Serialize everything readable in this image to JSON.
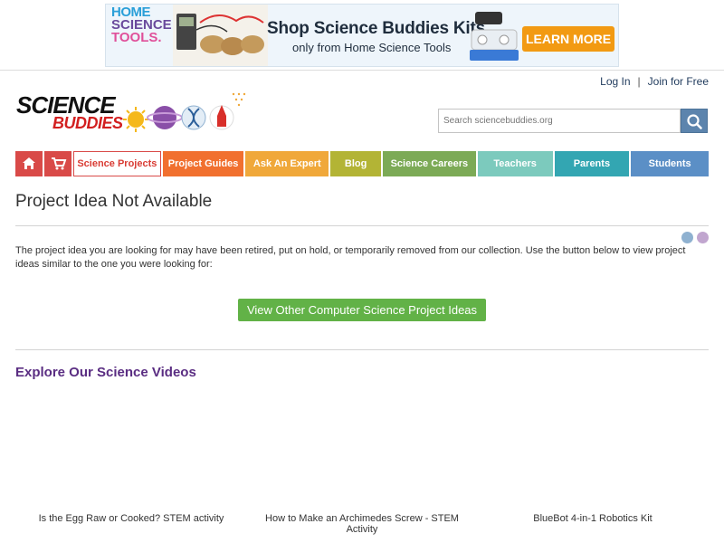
{
  "ad": {
    "logo_lines": [
      "HOME",
      "SCIENCE",
      "TOOLS."
    ],
    "title": "Shop Science Buddies Kits",
    "subtitle": "only from Home Science Tools",
    "button": "LEARN MORE"
  },
  "header": {
    "login": "Log In",
    "separator": "|",
    "join": "Join for Free",
    "logo_word1": "SCIENCE",
    "logo_word2": "BUDDIES",
    "search_placeholder": "Search sciencebuddies.org"
  },
  "nav": {
    "home_icon": "home-icon",
    "cart_icon": "cart-icon",
    "items": [
      {
        "label": "Science Projects",
        "color": "#d94a48",
        "active": true
      },
      {
        "label": "Project Guides",
        "color": "#f1702f"
      },
      {
        "label": "Ask An Expert",
        "color": "#f0a83a"
      },
      {
        "label": "Blog",
        "color": "#b3b435"
      },
      {
        "label": "Science Careers",
        "color": "#7caa56"
      },
      {
        "label": "Teachers",
        "color": "#7ccabd"
      },
      {
        "label": "Parents",
        "color": "#33a6b2"
      },
      {
        "label": "Students",
        "color": "#5b8fc6"
      }
    ]
  },
  "main": {
    "title": "Project Idea Not Available",
    "description": "The project idea you are looking for may have been retired, put on hold, or temporarily removed from our collection. Use the button below to view project ideas similar to the one you were looking for:",
    "cta": "View Other Computer Science Project Ideas",
    "videos_title": "Explore Our Science Videos",
    "videos": [
      {
        "caption": "Is the Egg Raw or Cooked? STEM activity"
      },
      {
        "caption": "How to Make an Archimedes Screw - STEM Activity"
      },
      {
        "caption": "BlueBot 4-in-1 Robotics Kit"
      }
    ]
  },
  "colors": {
    "accent_green": "#62b247",
    "title_purple": "#5a2d82",
    "search_button": "#5c84ad"
  }
}
